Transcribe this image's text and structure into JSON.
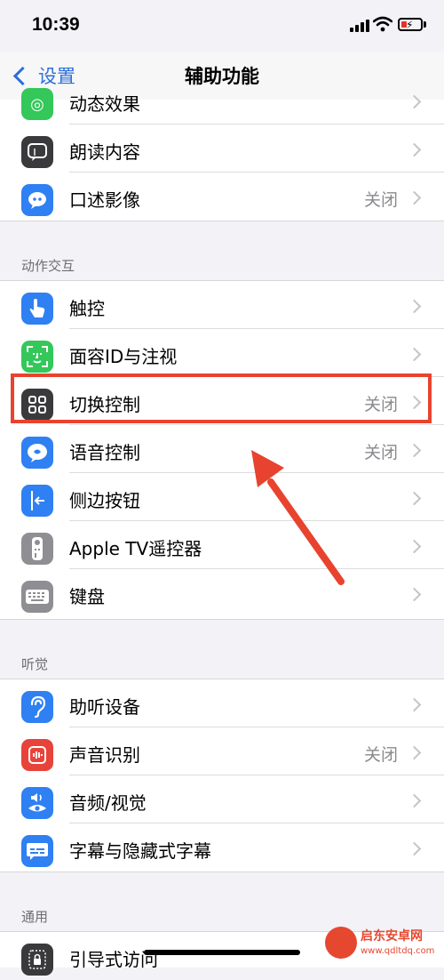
{
  "status_bar": {
    "time": "10:39"
  },
  "nav": {
    "back_label": "设置",
    "title": "辅助功能"
  },
  "sections": {
    "interaction_header": "动作交互",
    "hearing_header": "听觉",
    "general_header": "通用"
  },
  "vision_rows": [
    {
      "label": "动态效果",
      "value": ""
    },
    {
      "label": "朗读内容",
      "value": ""
    },
    {
      "label": "口述影像",
      "value": "关闭"
    }
  ],
  "interaction_rows": [
    {
      "label": "触控",
      "value": ""
    },
    {
      "label": "面容ID与注视",
      "value": ""
    },
    {
      "label": "切换控制",
      "value": "关闭"
    },
    {
      "label": "语音控制",
      "value": "关闭"
    },
    {
      "label": "侧边按钮",
      "value": ""
    },
    {
      "label": "Apple TV遥控器",
      "value": ""
    },
    {
      "label": "键盘",
      "value": ""
    }
  ],
  "hearing_rows": [
    {
      "label": "助听设备",
      "value": ""
    },
    {
      "label": "声音识别",
      "value": "关闭"
    },
    {
      "label": "音频/视觉",
      "value": ""
    },
    {
      "label": "字幕与隐藏式字幕",
      "value": ""
    }
  ],
  "general_rows": [
    {
      "label": "引导式访问",
      "value": ""
    }
  ],
  "watermark": {
    "title": "启东安卓网",
    "url": "www.qdltdq.com"
  },
  "colors": {
    "accent": "#2c6fda",
    "highlight": "#e8432e",
    "green": "#34c759",
    "dark": "#3a3a3c",
    "blue": "#2f80f2",
    "gray": "#8e8e93",
    "red": "#e8433a"
  }
}
